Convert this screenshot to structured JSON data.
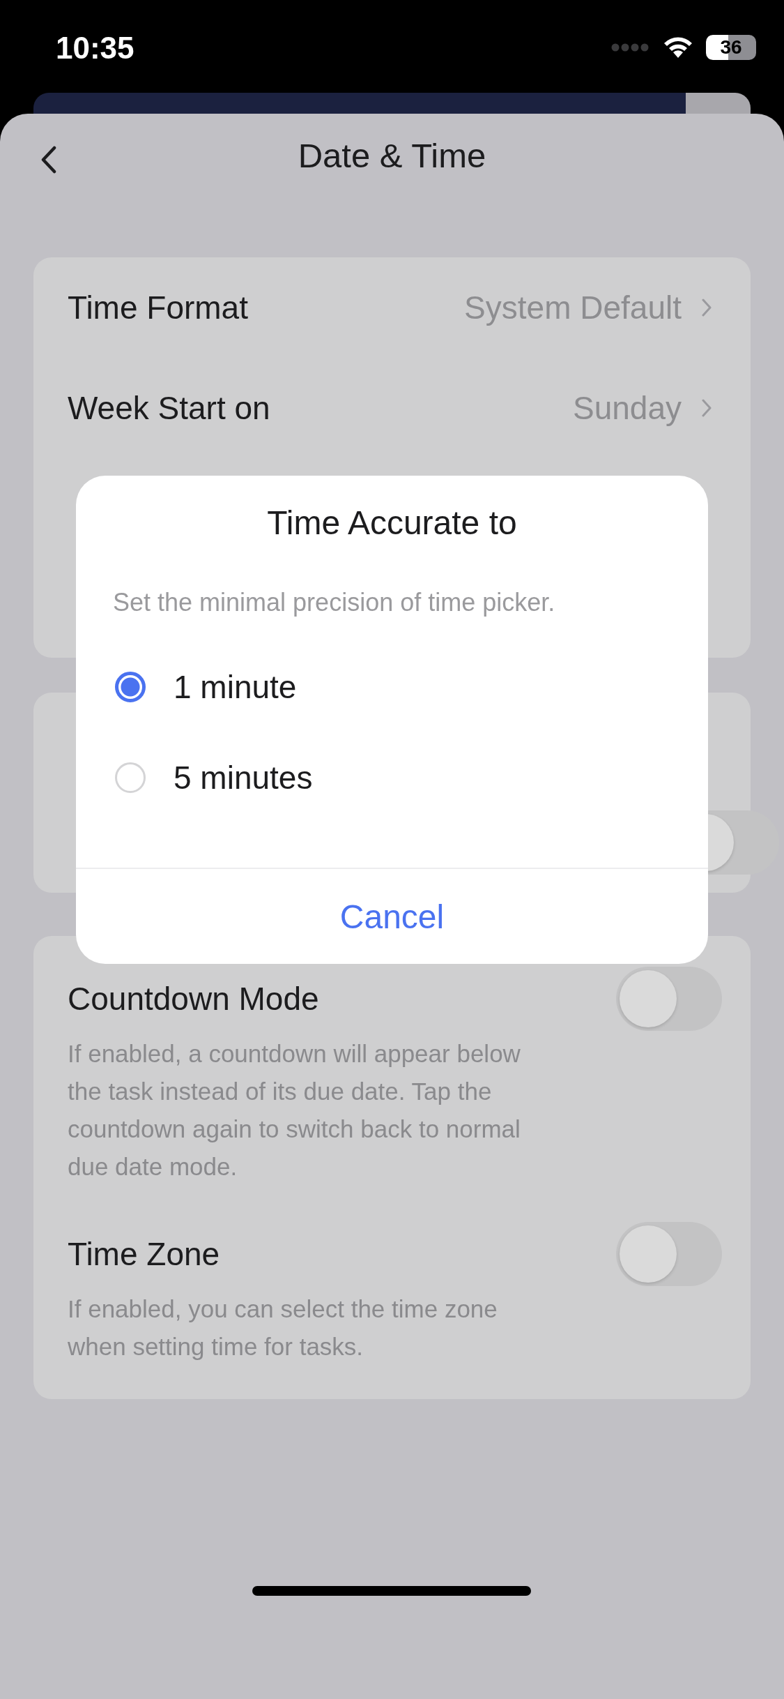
{
  "status_bar": {
    "time": "10:35",
    "battery": "36"
  },
  "header": {
    "title": "Date & Time"
  },
  "groups": [
    {
      "rows": [
        {
          "kind": "link",
          "label": "Time Format",
          "value": "System Default"
        },
        {
          "kind": "link",
          "label": "Week Start on",
          "value": "Sunday"
        }
      ]
    },
    {
      "rows": [
        {
          "kind": "switch",
          "on": false
        }
      ]
    },
    {
      "rows": [
        {
          "kind": "switch",
          "label": "Countdown Mode",
          "on": false,
          "description": "If enabled, a countdown will appear below the task instead of its due date. Tap the countdown again to switch back to normal due date mode."
        },
        {
          "kind": "switch",
          "label": "Time Zone",
          "on": false,
          "description": "If enabled, you can select the time zone when setting time for tasks."
        }
      ]
    }
  ],
  "dialog": {
    "title": "Time Accurate to",
    "message": "Set the minimal precision of time picker.",
    "options": [
      {
        "label": "1 minute",
        "selected": true
      },
      {
        "label": "5 minutes",
        "selected": false
      }
    ],
    "cancel": "Cancel"
  }
}
